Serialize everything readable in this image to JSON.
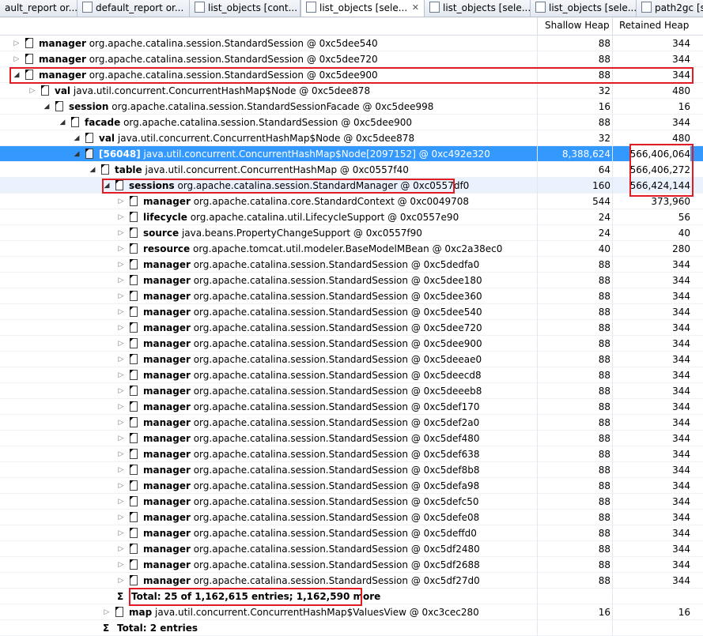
{
  "tabs": [
    {
      "label": "ault_report   or...",
      "active": false
    },
    {
      "label": "default_report   or...",
      "active": false
    },
    {
      "label": "list_objects [cont...",
      "active": false
    },
    {
      "label": "list_objects [sele...",
      "active": true
    },
    {
      "label": "list_objects [sele...",
      "active": false
    },
    {
      "label": "list_objects [sele...",
      "active": false
    },
    {
      "label": "path2gc [s",
      "active": false
    }
  ],
  "tab_close_glyph": "✕",
  "header": {
    "shallow": "Shallow Heap",
    "retained": "Retained Heap"
  },
  "rows": [
    {
      "name": "manager",
      "desc": "org.apache.catalina.session.StandardSession @ 0xc5dee540",
      "shallow": "88",
      "retained": "344"
    },
    {
      "name": "manager",
      "desc": "org.apache.catalina.session.StandardSession @ 0xc5dee720",
      "shallow": "88",
      "retained": "344"
    },
    {
      "name": "manager",
      "desc": "org.apache.catalina.session.StandardSession @ 0xc5dee900",
      "shallow": "88",
      "retained": "344"
    },
    {
      "name": "val",
      "desc": "java.util.concurrent.ConcurrentHashMap$Node @ 0xc5dee878",
      "shallow": "32",
      "retained": "480"
    },
    {
      "name": "session",
      "desc": "org.apache.catalina.session.StandardSessionFacade @ 0xc5dee998",
      "shallow": "16",
      "retained": "16"
    },
    {
      "name": "facade",
      "desc": "org.apache.catalina.session.StandardSession @ 0xc5dee900",
      "shallow": "88",
      "retained": "344"
    },
    {
      "name": "val",
      "desc": "java.util.concurrent.ConcurrentHashMap$Node @ 0xc5dee878",
      "shallow": "32",
      "retained": "480"
    },
    {
      "name": "[56048]",
      "desc": "java.util.concurrent.ConcurrentHashMap$Node[2097152] @ 0xc492e320",
      "shallow": "8,388,624",
      "retained": "566,406,064"
    },
    {
      "name": "table",
      "desc": "java.util.concurrent.ConcurrentHashMap @ 0xc0557f40",
      "shallow": "64",
      "retained": "566,406,272"
    },
    {
      "name": "sessions",
      "desc": "org.apache.catalina.session.StandardManager @ 0xc0557df0",
      "shallow": "160",
      "retained": "566,424,144"
    },
    {
      "name": "manager",
      "desc": "org.apache.catalina.core.StandardContext @ 0xc0049708",
      "shallow": "544",
      "retained": "373,960"
    },
    {
      "name": "lifecycle",
      "desc": "org.apache.catalina.util.LifecycleSupport @ 0xc0557e90",
      "shallow": "24",
      "retained": "56"
    },
    {
      "name": "source",
      "desc": "java.beans.PropertyChangeSupport @ 0xc0557f90",
      "shallow": "24",
      "retained": "40"
    },
    {
      "name": "resource",
      "desc": "org.apache.tomcat.util.modeler.BaseModelMBean @ 0xc2a38ec0",
      "shallow": "40",
      "retained": "280"
    },
    {
      "name": "manager",
      "desc": "org.apache.catalina.session.StandardSession @ 0xc5dedfa0",
      "shallow": "88",
      "retained": "344"
    },
    {
      "name": "manager",
      "desc": "org.apache.catalina.session.StandardSession @ 0xc5dee180",
      "shallow": "88",
      "retained": "344"
    },
    {
      "name": "manager",
      "desc": "org.apache.catalina.session.StandardSession @ 0xc5dee360",
      "shallow": "88",
      "retained": "344"
    },
    {
      "name": "manager",
      "desc": "org.apache.catalina.session.StandardSession @ 0xc5dee540",
      "shallow": "88",
      "retained": "344"
    },
    {
      "name": "manager",
      "desc": "org.apache.catalina.session.StandardSession @ 0xc5dee720",
      "shallow": "88",
      "retained": "344"
    },
    {
      "name": "manager",
      "desc": "org.apache.catalina.session.StandardSession @ 0xc5dee900",
      "shallow": "88",
      "retained": "344"
    },
    {
      "name": "manager",
      "desc": "org.apache.catalina.session.StandardSession @ 0xc5deeae0",
      "shallow": "88",
      "retained": "344"
    },
    {
      "name": "manager",
      "desc": "org.apache.catalina.session.StandardSession @ 0xc5deecd8",
      "shallow": "88",
      "retained": "344"
    },
    {
      "name": "manager",
      "desc": "org.apache.catalina.session.StandardSession @ 0xc5deeeb8",
      "shallow": "88",
      "retained": "344"
    },
    {
      "name": "manager",
      "desc": "org.apache.catalina.session.StandardSession @ 0xc5def170",
      "shallow": "88",
      "retained": "344"
    },
    {
      "name": "manager",
      "desc": "org.apache.catalina.session.StandardSession @ 0xc5def2a0",
      "shallow": "88",
      "retained": "344"
    },
    {
      "name": "manager",
      "desc": "org.apache.catalina.session.StandardSession @ 0xc5def480",
      "shallow": "88",
      "retained": "344"
    },
    {
      "name": "manager",
      "desc": "org.apache.catalina.session.StandardSession @ 0xc5def638",
      "shallow": "88",
      "retained": "344"
    },
    {
      "name": "manager",
      "desc": "org.apache.catalina.session.StandardSession @ 0xc5def8b8",
      "shallow": "88",
      "retained": "344"
    },
    {
      "name": "manager",
      "desc": "org.apache.catalina.session.StandardSession @ 0xc5defa98",
      "shallow": "88",
      "retained": "344"
    },
    {
      "name": "manager",
      "desc": "org.apache.catalina.session.StandardSession @ 0xc5defc50",
      "shallow": "88",
      "retained": "344"
    },
    {
      "name": "manager",
      "desc": "org.apache.catalina.session.StandardSession @ 0xc5defe08",
      "shallow": "88",
      "retained": "344"
    },
    {
      "name": "manager",
      "desc": "org.apache.catalina.session.StandardSession @ 0xc5deffd0",
      "shallow": "88",
      "retained": "344"
    },
    {
      "name": "manager",
      "desc": "org.apache.catalina.session.StandardSession @ 0xc5df2480",
      "shallow": "88",
      "retained": "344"
    },
    {
      "name": "manager",
      "desc": "org.apache.catalina.session.StandardSession @ 0xc5df2688",
      "shallow": "88",
      "retained": "344"
    },
    {
      "name": "manager",
      "desc": "org.apache.catalina.session.StandardSession @ 0xc5df27d0",
      "shallow": "88",
      "retained": "344"
    },
    {
      "summary": "Total: 25 of 1,162,615 entries; 1,162,590 more"
    },
    {
      "name": "map",
      "desc": "java.util.concurrent.ConcurrentHashMap$ValuesView @ 0xc3cec280",
      "shallow": "16",
      "retained": "16"
    },
    {
      "summary": "Total: 2 entries"
    }
  ],
  "colors": {
    "selection": "#3399ff",
    "highlight_box": "#e31b23"
  }
}
